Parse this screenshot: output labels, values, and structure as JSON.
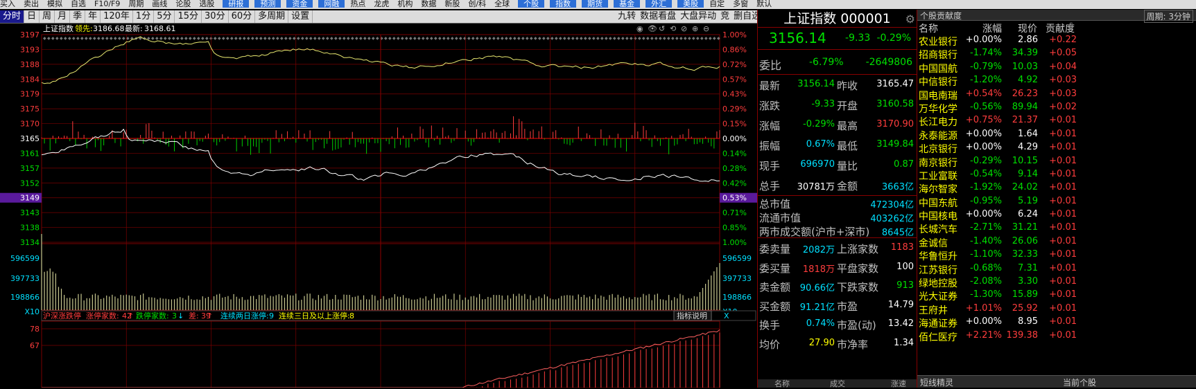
{
  "topmenu": [
    "买入",
    "卖出",
    "模拟",
    "自选",
    "F10/F9",
    "周期",
    "画线",
    "论股",
    "选股",
    "研报",
    "预测",
    "资金",
    "网融",
    "热点",
    "龙虎",
    "机构",
    "数据",
    "新股",
    "创/科",
    "全球",
    "个股",
    "指数",
    "期货",
    "基金",
    "外汇",
    "美股",
    "自定",
    "多窗",
    "默认"
  ],
  "timebar": {
    "tabs": [
      "分时",
      "日",
      "周",
      "月",
      "季",
      "年",
      "120年",
      "1分",
      "5分",
      "15分",
      "30分",
      "60分",
      "多周期",
      "设置"
    ],
    "right": [
      "九转",
      "数据看盘",
      "大盘异动",
      "竞",
      "删自选",
      "⊣◀",
      "▾"
    ]
  },
  "chart": {
    "header": {
      "name": "上证指数",
      "lead_label": "领先:",
      "lead_value": "3186.68",
      "latest_label": "最新:",
      "latest_value": "3168.61"
    },
    "price_axis": [
      "3197",
      "3193",
      "3188",
      "3184",
      "3179",
      "3175",
      "3170",
      "3165",
      "3161",
      "3157",
      "3152",
      "3149",
      "3143",
      "3138",
      "3134"
    ],
    "pct_axis": [
      "1.00%",
      "0.86%",
      "0.72%",
      "0.57%",
      "0.43%",
      "0.29%",
      "0.15%",
      "0.00%",
      "0.14%",
      "0.28%",
      "0.42%",
      "0.53%",
      "0.71%",
      "0.85%",
      "1.00%"
    ],
    "current_price_tag": "3149",
    "current_pct_tag": "0.53%",
    "vol_axis": [
      "596599",
      "397733",
      "198866",
      "X10"
    ],
    "bottom_bar": {
      "label": "沪深涨跌停",
      "up_label": "涨停家数:",
      "up_value": "42",
      "down_label": "跌停家数:",
      "down_value": "3",
      "diff_label": "差:",
      "diff_value": "39",
      "two_day_label": "连续两日涨停:",
      "two_day_value": "9",
      "three_day_label": "连续三日及以上涨停:",
      "three_day_value": "8",
      "button": "指标说明",
      "close": "X"
    },
    "sub_axis": [
      "78",
      "67"
    ],
    "colors": {
      "price_line": "#ffffff",
      "avg_line": "#e8e870",
      "up": "#ff3d3d",
      "down": "#00d000",
      "grid": "#7a0000",
      "axis_red": "#ff3d3d",
      "axis_green": "#00e000",
      "vol": "#c8c890"
    }
  },
  "info": {
    "title": "上证指数 000001",
    "price": "3156.14",
    "change": "-9.33",
    "change_pct": "-0.29%",
    "weibi_label": "委比",
    "weibi_pct": "-6.79%",
    "weibi_val": "-2649806",
    "rows": [
      {
        "l1": "最新",
        "v1": "3156.14",
        "l2": "昨收",
        "v2": "3165.47",
        "c1": "green",
        "c2": "white"
      },
      {
        "l1": "涨跌",
        "v1": "-9.33",
        "l2": "开盘",
        "v2": "3160.58",
        "c1": "green",
        "c2": "green"
      },
      {
        "l1": "涨幅",
        "v1": "-0.29%",
        "l2": "最高",
        "v2": "3170.90",
        "c1": "green",
        "c2": "red"
      },
      {
        "l1": "振幅",
        "v1": "0.67%",
        "l2": "最低",
        "v2": "3149.84",
        "c1": "cyan",
        "c2": "green"
      },
      {
        "l1": "现手",
        "v1": "696970",
        "l2": "量比",
        "v2": "0.87",
        "c1": "cyan",
        "c2": "green"
      },
      {
        "l1": "总手",
        "v1": "30781万",
        "l2": "金额",
        "v2": "3663亿",
        "c1": "white",
        "c2": "cyan"
      }
    ],
    "caps": [
      {
        "l": "总市值",
        "v": "472304亿"
      },
      {
        "l": "流通市值",
        "v": "403262亿"
      },
      {
        "l": "两市成交额(沪市+深市)",
        "v": "8645亿"
      }
    ],
    "rows2": [
      {
        "l1": "委卖量",
        "v1": "2082万",
        "l2": "上涨家数",
        "v2": "1183",
        "c1": "cyan",
        "c2": "red"
      },
      {
        "l1": "委买量",
        "v1": "1818万",
        "l2": "平盘家数",
        "v2": "100",
        "c1": "red",
        "c2": "white"
      },
      {
        "l1": "卖金额",
        "v1": "90.66亿",
        "l2": "下跌家数",
        "v2": "913",
        "c1": "cyan",
        "c2": "green"
      },
      {
        "l1": "买金额",
        "v1": "91.21亿",
        "l2": "市盈",
        "v2": "14.79",
        "c1": "cyan",
        "c2": "white"
      },
      {
        "l1": "换手",
        "v1": "0.74%",
        "l2": "市盈(动)",
        "v2": "13.42",
        "c1": "cyan",
        "c2": "white"
      },
      {
        "l1": "均价",
        "v1": "27.90",
        "l2": "市净率",
        "v2": "1.34",
        "c1": "yellow",
        "c2": "white"
      }
    ],
    "foot_labels": [
      "名称",
      "成交",
      "涨速"
    ]
  },
  "contrib": {
    "title": "个股贡献度",
    "period": "周期: 3分钟",
    "cols": [
      "名称",
      "涨幅",
      "现价",
      "贡献度"
    ],
    "rows": [
      {
        "n": "农业银行",
        "p": "+0.00%",
        "pr": "2.86",
        "c": "+0.22",
        "pc": "white",
        "prc": "white"
      },
      {
        "n": "招商银行",
        "p": "-1.74%",
        "pr": "34.39",
        "c": "+0.05",
        "pc": "green",
        "prc": "green"
      },
      {
        "n": "中国国航",
        "p": "-0.79%",
        "pr": "10.03",
        "c": "+0.04",
        "pc": "green",
        "prc": "green"
      },
      {
        "n": "中信银行",
        "p": "-1.20%",
        "pr": "4.92",
        "c": "+0.03",
        "pc": "green",
        "prc": "green"
      },
      {
        "n": "国电南瑞",
        "p": "+0.54%",
        "pr": "26.23",
        "c": "+0.03",
        "pc": "red",
        "prc": "red"
      },
      {
        "n": "万华化学",
        "p": "-0.56%",
        "pr": "89.94",
        "c": "+0.02",
        "pc": "green",
        "prc": "green"
      },
      {
        "n": "长江电力",
        "p": "+0.75%",
        "pr": "21.37",
        "c": "+0.01",
        "pc": "red",
        "prc": "red"
      },
      {
        "n": "永泰能源",
        "p": "+0.00%",
        "pr": "1.64",
        "c": "+0.01",
        "pc": "white",
        "prc": "white"
      },
      {
        "n": "北京银行",
        "p": "+0.00%",
        "pr": "4.29",
        "c": "+0.01",
        "pc": "white",
        "prc": "white"
      },
      {
        "n": "南京银行",
        "p": "-0.29%",
        "pr": "10.15",
        "c": "+0.01",
        "pc": "green",
        "prc": "green"
      },
      {
        "n": "工业富联",
        "p": "-0.54%",
        "pr": "9.14",
        "c": "+0.01",
        "pc": "green",
        "prc": "green"
      },
      {
        "n": "海尔智家",
        "p": "-1.92%",
        "pr": "24.02",
        "c": "+0.01",
        "pc": "green",
        "prc": "green"
      },
      {
        "n": "中国东航",
        "p": "-0.95%",
        "pr": "5.19",
        "c": "+0.01",
        "pc": "green",
        "prc": "green"
      },
      {
        "n": "中国核电",
        "p": "+0.00%",
        "pr": "6.24",
        "c": "+0.01",
        "pc": "white",
        "prc": "white"
      },
      {
        "n": "长城汽车",
        "p": "-2.71%",
        "pr": "31.21",
        "c": "+0.01",
        "pc": "green",
        "prc": "green"
      },
      {
        "n": "金诚信",
        "p": "-1.40%",
        "pr": "26.06",
        "c": "+0.01",
        "pc": "green",
        "prc": "green"
      },
      {
        "n": "华鲁恒升",
        "p": "-1.10%",
        "pr": "32.33",
        "c": "+0.01",
        "pc": "green",
        "prc": "green"
      },
      {
        "n": "江苏银行",
        "p": "-0.68%",
        "pr": "7.31",
        "c": "+0.01",
        "pc": "green",
        "prc": "green"
      },
      {
        "n": "绿地控股",
        "p": "-2.08%",
        "pr": "3.30",
        "c": "+0.01",
        "pc": "green",
        "prc": "green"
      },
      {
        "n": "光大证券",
        "p": "-1.30%",
        "pr": "15.89",
        "c": "+0.01",
        "pc": "green",
        "prc": "green"
      },
      {
        "n": "王府井",
        "p": "+1.01%",
        "pr": "25.92",
        "c": "+0.01",
        "pc": "red",
        "prc": "red"
      },
      {
        "n": "海通证券",
        "p": "+0.00%",
        "pr": "8.95",
        "c": "+0.01",
        "pc": "white",
        "prc": "white"
      },
      {
        "n": "佰仁医疗",
        "p": "+2.21%",
        "pr": "139.38",
        "c": "+0.01",
        "pc": "red",
        "prc": "red"
      }
    ],
    "foot_left": "短线精灵",
    "foot_right": "当前个股"
  }
}
